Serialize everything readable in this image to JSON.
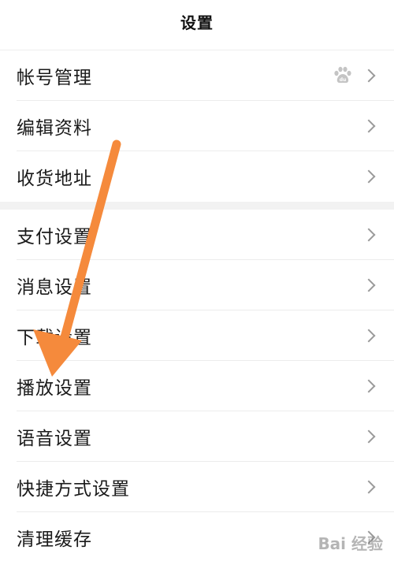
{
  "header": {
    "title": "设置"
  },
  "sections": [
    {
      "items": [
        {
          "label": "帐号管理",
          "badge_icon": "baidu-paw-icon"
        },
        {
          "label": "编辑资料"
        },
        {
          "label": "收货地址"
        }
      ]
    },
    {
      "items": [
        {
          "label": "支付设置"
        },
        {
          "label": "消息设置"
        },
        {
          "label": "下载设置"
        },
        {
          "label": "播放设置"
        },
        {
          "label": "语音设置"
        },
        {
          "label": "快捷方式设置"
        },
        {
          "label": "清理缓存"
        }
      ]
    }
  ],
  "colors": {
    "annotation_arrow": "#f58a3c",
    "chevron": "#9a9a9a",
    "section_gap": "#f2f2f2"
  },
  "watermark": {
    "text": "Bai 经验"
  }
}
